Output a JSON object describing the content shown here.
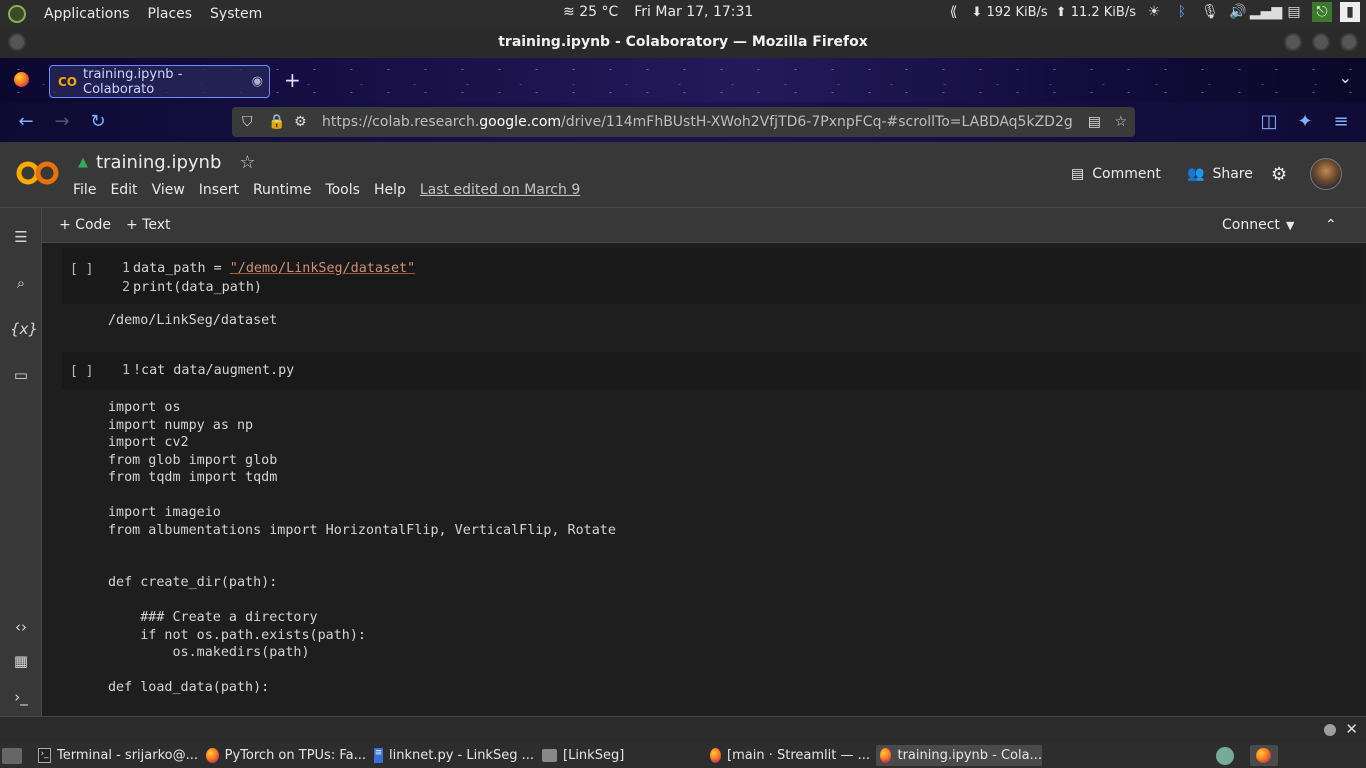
{
  "system_panel": {
    "menus": [
      "Applications",
      "Places",
      "System"
    ],
    "weather": "25 °C",
    "clock": "Fri Mar 17, 17:31",
    "net_down": "192 KiB/s",
    "net_up": "11.2 KiB/s"
  },
  "window": {
    "title": "training.ipynb - Colaboratory — Mozilla Firefox"
  },
  "browser": {
    "tab_title": "training.ipynb - Colaborato",
    "url_prefix": "https://colab.research.",
    "url_domain": "google.com",
    "url_suffix": "/drive/114mFhBUstH-XWoh2VfjTD6-7PxnpFCq-#scrollTo=LABDAq5kZD2g"
  },
  "colab": {
    "notebook_title": "training.ipynb",
    "menu": [
      "File",
      "Edit",
      "View",
      "Insert",
      "Runtime",
      "Tools",
      "Help"
    ],
    "last_edited": "Last edited on March 9",
    "comment_label": "Comment",
    "share_label": "Share",
    "add_code_label": "+ Code",
    "add_text_label": "+ Text",
    "connect_label": "Connect"
  },
  "cells": [
    {
      "run": "[ ]",
      "lines": [
        "1",
        "2"
      ],
      "code_line1_prefix": "data_path = ",
      "code_line1_string": "\"/demo/LinkSeg/dataset\"",
      "code_line2": "print(data_path)",
      "output": "/demo/LinkSeg/dataset"
    },
    {
      "run": "[ ]",
      "lines": [
        "1"
      ],
      "code_line1": "!cat data/augment.py",
      "output": "import os\nimport numpy as np\nimport cv2\nfrom glob import glob\nfrom tqdm import tqdm\n\nimport imageio\nfrom albumentations import HorizontalFlip, VerticalFlip, Rotate\n\n\ndef create_dir(path):\n\n    ### Create a directory\n    if not os.path.exists(path):\n        os.makedirs(path)\n\ndef load_data(path):\n\n    \"\"\" Split data into train and test set\"\"\""
    }
  ],
  "taskbar": [
    {
      "label": "Terminal - srijarko@..."
    },
    {
      "label": "PyTorch on TPUs: Fa..."
    },
    {
      "label": "linknet.py - LinkSeg ..."
    },
    {
      "label": "[LinkSeg]"
    },
    {
      "label": "[main · Streamlit — ..."
    },
    {
      "label": "training.ipynb - Cola..."
    }
  ],
  "colors": {
    "colab_orange": "#f9ab00",
    "accent_blue": "#6b8cff"
  }
}
